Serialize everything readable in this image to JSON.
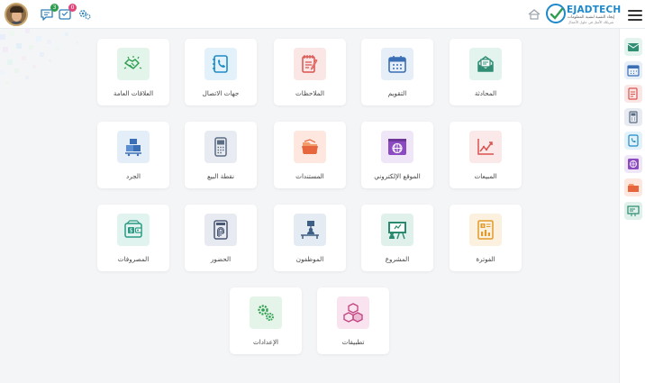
{
  "header": {
    "logo_text": "EJADTECH",
    "logo_sub": "إيجاد التقنية لتقنية المعلومات",
    "logo_sub2": "شريكك الأمثل في حلول الأعمال",
    "chat_badge": "3",
    "notif_badge": "0",
    "colors": {
      "chat_badge": "#2e9e4f",
      "notif_badge": "#e0457b",
      "logo": "#1e88c8"
    }
  },
  "modules": [
    {
      "label": "المحادثة",
      "icon": "chat-envelope-icon",
      "tile_color": "#e3f3ee"
    },
    {
      "label": "التقويم",
      "icon": "calendar-icon",
      "tile_color": "#e6eef8"
    },
    {
      "label": "الملاحظات",
      "icon": "notes-icon",
      "tile_color": "#fbe6e6"
    },
    {
      "label": "جهات الاتصال",
      "icon": "phone-book-icon",
      "tile_color": "#e2f1fa"
    },
    {
      "label": "العلاقات العامة",
      "icon": "handshake-icon",
      "tile_color": "#e3f4ea"
    },
    {
      "label": "المبيعات",
      "icon": "sales-chart-icon",
      "tile_color": "#fbe8e8"
    },
    {
      "label": "الموقع الإلكتروني",
      "icon": "website-globe-icon",
      "tile_color": "#efe6f7"
    },
    {
      "label": "المستندات",
      "icon": "documents-icon",
      "tile_color": "#fde7de"
    },
    {
      "label": "نقطة البيع",
      "icon": "pos-terminal-icon",
      "tile_color": "#e8ecf2"
    },
    {
      "label": "الجرد",
      "icon": "inventory-boxes-icon",
      "tile_color": "#e4eef8"
    },
    {
      "label": "الفوترة",
      "icon": "invoice-icon",
      "tile_color": "#fcf0de"
    },
    {
      "label": "المشروع",
      "icon": "project-board-icon",
      "tile_color": "#e0f1ec"
    },
    {
      "label": "الموظفون",
      "icon": "employee-desk-icon",
      "tile_color": "#e4ebf3"
    },
    {
      "label": "الحضور",
      "icon": "attendance-fingerprint-icon",
      "tile_color": "#e7eaf1"
    },
    {
      "label": "المصروفات",
      "icon": "expenses-wallet-icon",
      "tile_color": "#e0f3ee"
    },
    {
      "label": "تطبيقات",
      "icon": "apps-cubes-icon",
      "tile_color": "#f9e3ef"
    },
    {
      "label": "الإعدادات",
      "icon": "settings-gears-icon",
      "tile_color": "#e4f4e9"
    }
  ],
  "sidebar": {
    "items": [
      {
        "icon": "chat-envelope-icon"
      },
      {
        "icon": "calendar-icon"
      },
      {
        "icon": "notes-icon"
      },
      {
        "icon": "pos-terminal-icon"
      },
      {
        "icon": "phone-book-icon"
      },
      {
        "icon": "website-globe-icon"
      },
      {
        "icon": "documents-icon"
      },
      {
        "icon": "project-board-icon"
      }
    ]
  }
}
